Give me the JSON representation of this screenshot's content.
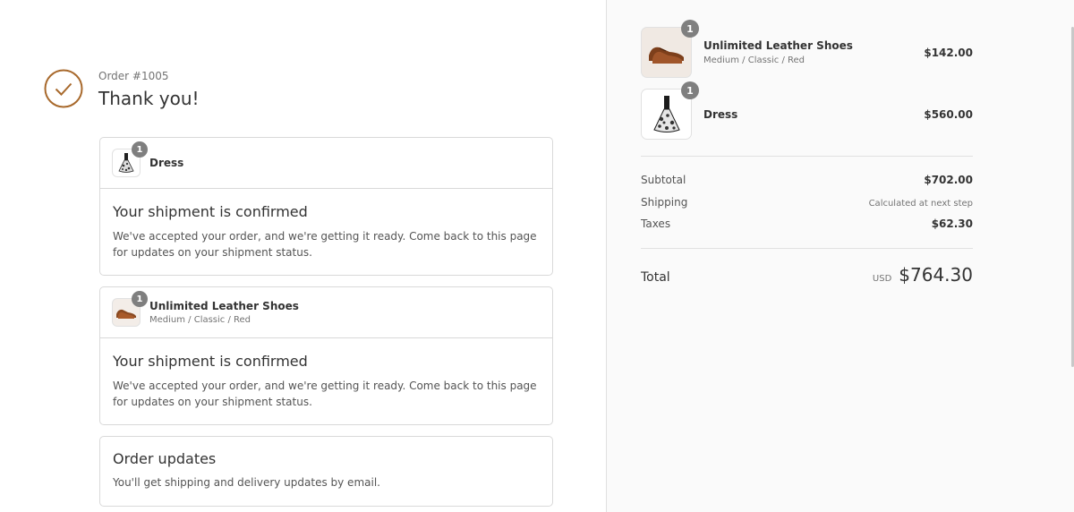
{
  "header": {
    "order_number": "Order #1005",
    "thank_you": "Thank you!"
  },
  "shipments": [
    {
      "product": "Dress",
      "variant": "",
      "quantity": "1",
      "title": "Your shipment is confirmed",
      "text": "We've accepted your order, and we're getting it ready. Come back to this page for updates on your shipment status."
    },
    {
      "product": "Unlimited Leather Shoes",
      "variant": "Medium / Classic / Red",
      "quantity": "1",
      "title": "Your shipment is confirmed",
      "text": "We've accepted your order, and we're getting it ready. Come back to this page for updates on your shipment status."
    }
  ],
  "order_updates": {
    "title": "Order updates",
    "text": "You'll get shipping and delivery updates by email."
  },
  "summary": {
    "items": [
      {
        "name": "Unlimited Leather Shoes",
        "variant": "Medium / Classic / Red",
        "quantity": "1",
        "price": "$142.00",
        "icon": "shoe-image"
      },
      {
        "name": "Dress",
        "variant": "",
        "quantity": "1",
        "price": "$560.00",
        "icon": "dress-image"
      }
    ],
    "subtotal_label": "Subtotal",
    "subtotal_value": "$702.00",
    "shipping_label": "Shipping",
    "shipping_value": "Calculated at next step",
    "taxes_label": "Taxes",
    "taxes_value": "$62.30",
    "total_label": "Total",
    "currency": "USD",
    "total_value": "$764.30"
  },
  "colors": {
    "accent": "#a8692c",
    "badge": "#7f7f7f",
    "sidebar_bg": "#fafafa"
  }
}
